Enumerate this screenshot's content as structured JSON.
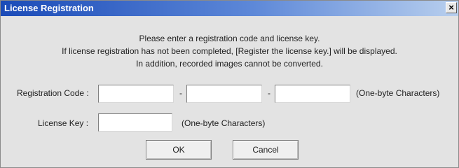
{
  "window": {
    "title": "License Registration",
    "close_glyph": "×",
    "close_icon": "close-icon"
  },
  "message": {
    "line1": "Please enter a registration code and license key.",
    "line2": "If license registration has not been completed, [Register the license key.] will be displayed.",
    "line3": "In addition, recorded images cannot be converted."
  },
  "registration": {
    "label": "Registration Code :",
    "separator": "-",
    "part1_value": "",
    "part2_value": "",
    "part3_value": "",
    "hint": "(One-byte Characters)"
  },
  "license": {
    "label": "License Key :",
    "value": "",
    "hint": "(One-byte Characters)"
  },
  "buttons": {
    "ok": "OK",
    "cancel": "Cancel"
  },
  "colors": {
    "titlebar_start": "#1b4bb8",
    "titlebar_end": "#b8cfee",
    "dialog_background": "#e3e3e3"
  }
}
